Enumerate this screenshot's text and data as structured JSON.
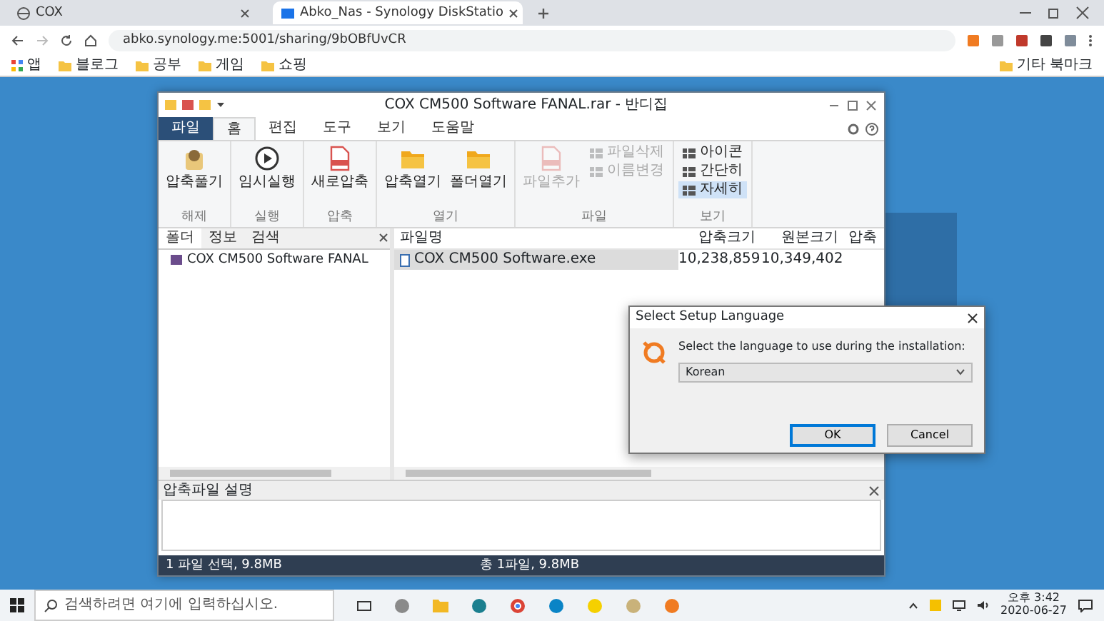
{
  "browser": {
    "tabs": [
      {
        "title": "COX",
        "selected": false
      },
      {
        "title": "Abko_Nas - Synology DiskStatio",
        "selected": true
      }
    ],
    "address": "abko.synology.me:5001/sharing/9bOBfUvCR",
    "bookmarks": [
      {
        "label": "앱",
        "kind": "apps"
      },
      {
        "label": "블로그",
        "kind": "folder"
      },
      {
        "label": "공부",
        "kind": "folder"
      },
      {
        "label": "게임",
        "kind": "folder"
      },
      {
        "label": "쇼핑",
        "kind": "folder"
      }
    ],
    "other_bookmarks": "기타 북마크"
  },
  "window": {
    "title": "COX CM500 Software FANAL.rar - 반디집",
    "menu_tabs": [
      {
        "label": "파일",
        "kind": "file",
        "selected": false
      },
      {
        "label": "홈",
        "kind": "tab",
        "selected": true
      },
      {
        "label": "편집",
        "kind": "tab",
        "selected": false
      },
      {
        "label": "도구",
        "kind": "tab",
        "selected": false
      },
      {
        "label": "보기",
        "kind": "tab",
        "selected": false
      },
      {
        "label": "도움말",
        "kind": "tab",
        "selected": false
      }
    ],
    "ribbon_groups": [
      {
        "label": "해제",
        "buttons": [
          {
            "label": "압축풀기",
            "kind": "large",
            "disabled": false,
            "selected": false
          }
        ]
      },
      {
        "label": "실행",
        "buttons": [
          {
            "label": "임시실행",
            "kind": "large",
            "disabled": false,
            "selected": false
          }
        ]
      },
      {
        "label": "압축",
        "buttons": [
          {
            "label": "새로압축",
            "kind": "large",
            "disabled": false,
            "selected": false
          }
        ]
      },
      {
        "label": "열기",
        "buttons": [
          {
            "label": "압축열기",
            "kind": "large",
            "disabled": false,
            "selected": false
          },
          {
            "label": "폴더열기",
            "kind": "large",
            "disabled": false,
            "selected": false
          }
        ]
      },
      {
        "label": "파일",
        "buttons": [
          {
            "label": "파일추가",
            "kind": "large",
            "disabled": true,
            "selected": false
          },
          {
            "label": "파일삭제",
            "kind": "small",
            "disabled": true,
            "selected": false
          },
          {
            "label": "이름변경",
            "kind": "small",
            "disabled": true,
            "selected": false
          }
        ]
      },
      {
        "label": "보기",
        "buttons": [
          {
            "label": "아이콘",
            "kind": "small",
            "disabled": false,
            "selected": false
          },
          {
            "label": "간단히",
            "kind": "small",
            "disabled": false,
            "selected": false
          },
          {
            "label": "자세히",
            "kind": "small",
            "disabled": false,
            "selected": true
          }
        ]
      }
    ],
    "left_tabs": [
      {
        "label": "폴더",
        "selected": true
      },
      {
        "label": "정보",
        "selected": false
      },
      {
        "label": "검색",
        "selected": false
      }
    ],
    "tree": [
      {
        "label": "COX CM500 Software FANAL"
      }
    ],
    "columns": [
      "파일명",
      "압축크기",
      "원본크기",
      "압축"
    ],
    "rows": [
      {
        "cells": [
          "COX CM500 Software.exe",
          "10,238,859",
          "10,349,402"
        ],
        "selected": true
      }
    ],
    "comment_title": "압축파일 설명",
    "status_left": "1 파일 선택, 9.8MB",
    "status_right": "총 1파일, 9.8MB"
  },
  "dialog": {
    "title": "Select Setup Language",
    "message": "Select the language to use during the installation:",
    "language": "Korean",
    "buttons": [
      {
        "label": "OK",
        "default": true
      },
      {
        "label": "Cancel",
        "default": false
      }
    ]
  },
  "taskbar": {
    "search_placeholder": "검색하려면 여기에 입력하십시오.",
    "apps": [
      {
        "kind": "taskview"
      },
      {
        "kind": "app",
        "color": "#8a8a8a"
      },
      {
        "kind": "folder",
        "color": "#f2b824"
      },
      {
        "kind": "app",
        "color": "#1b7f8f"
      },
      {
        "kind": "browser",
        "color": "#db4437"
      },
      {
        "kind": "app",
        "color": "#0a84c6"
      },
      {
        "kind": "app",
        "color": "#f5d000"
      },
      {
        "kind": "app",
        "color": "#c9b27a"
      },
      {
        "kind": "app",
        "color": "#f07b22"
      }
    ],
    "time": "오후 3:42",
    "date": "2020-06-27"
  }
}
